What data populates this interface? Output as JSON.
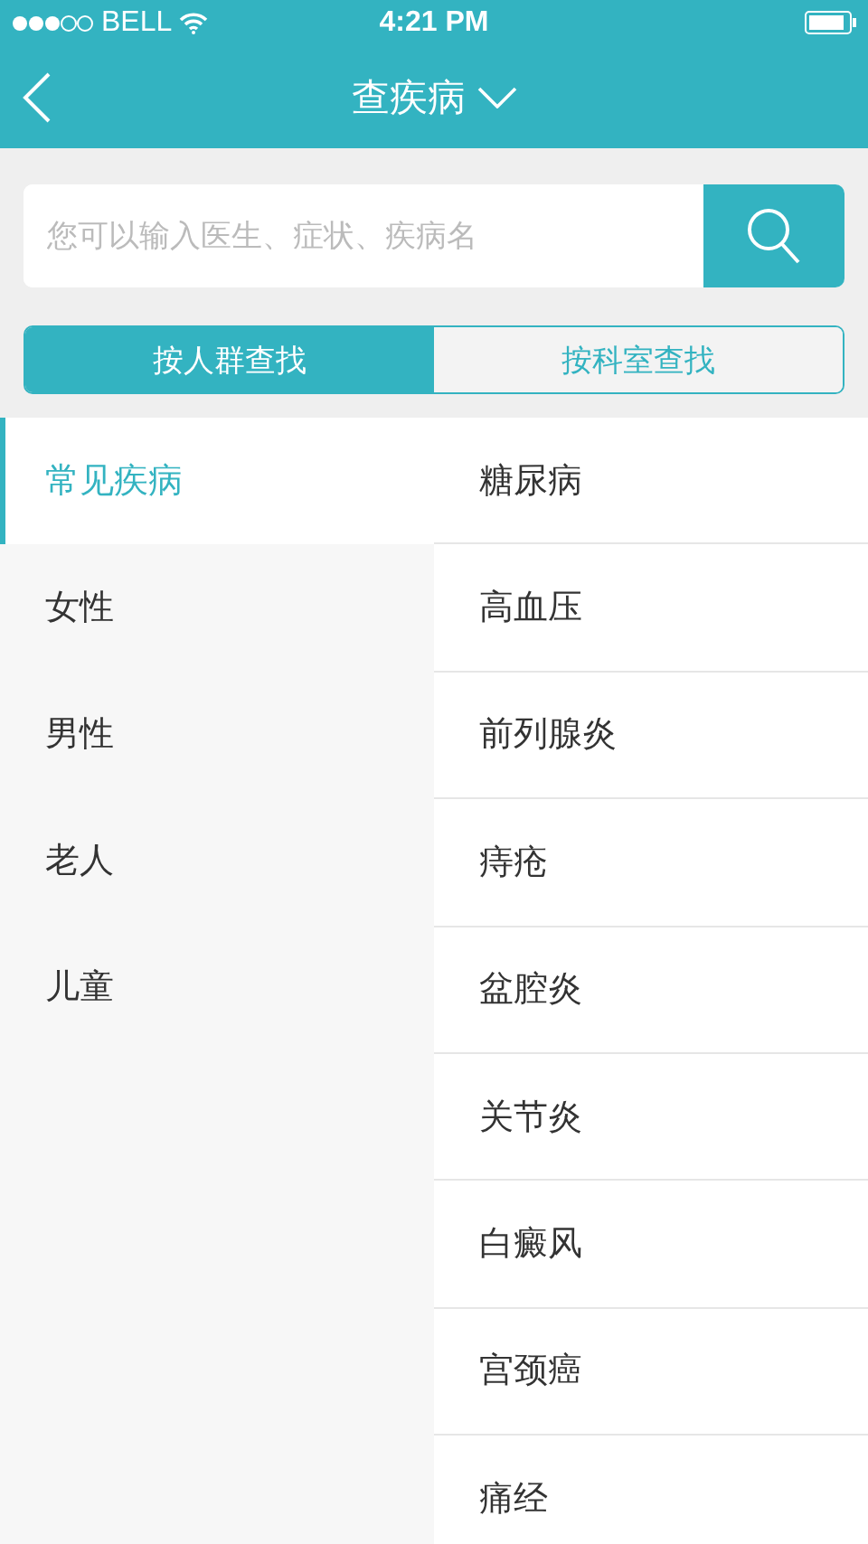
{
  "status_bar": {
    "carrier": "BELL",
    "time": "4:21 PM"
  },
  "nav_bar": {
    "title": "查疾病"
  },
  "search": {
    "placeholder": "您可以输入医生、症状、疾病名"
  },
  "tabs": [
    {
      "label": "按人群查找",
      "selected": true
    },
    {
      "label": "按科室查找",
      "selected": false
    }
  ],
  "categories": [
    {
      "label": "常见疾病",
      "selected": true
    },
    {
      "label": "女性",
      "selected": false
    },
    {
      "label": "男性",
      "selected": false
    },
    {
      "label": "老人",
      "selected": false
    },
    {
      "label": "儿童",
      "selected": false
    }
  ],
  "diseases": [
    "糖尿病",
    "高血压",
    "前列腺炎",
    "痔疮",
    "盆腔炎",
    "关节炎",
    "白癜风",
    "宫颈癌",
    "痛经"
  ]
}
